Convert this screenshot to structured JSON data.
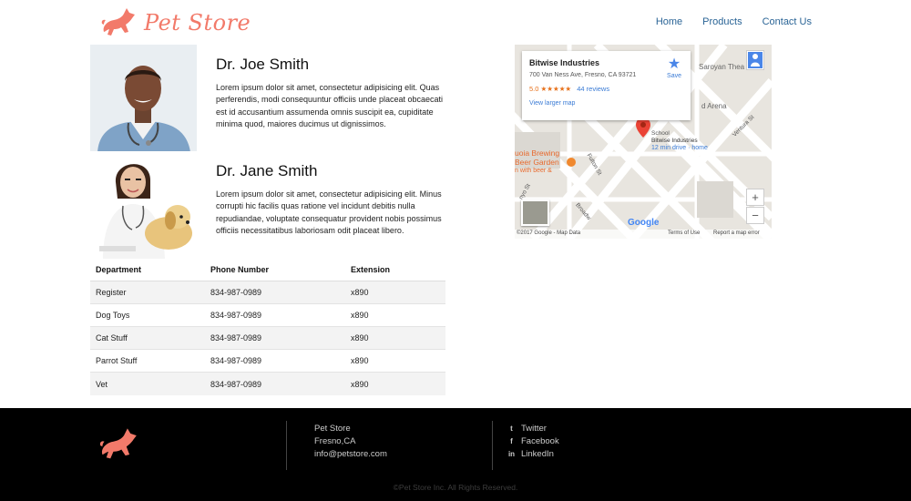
{
  "brand": {
    "name": "Pet Store",
    "accent": "#f27a6a",
    "logo_icon": "running-dog-icon"
  },
  "nav": {
    "items": [
      "Home",
      "Products",
      "Contact Us"
    ]
  },
  "doctors": [
    {
      "name": "Dr. Joe Smith",
      "bio": "Lorem ipsum dolor sit amet, consectetur adipisicing elit. Quas perferendis, modi consequuntur officiis unde placeat obcaecati est id accusantium assumenda omnis suscipit ea, cupiditate minima quod, maiores ducimus ut dignissimos."
    },
    {
      "name": "Dr. Jane Smith",
      "bio": "Lorem ipsum dolor sit amet, consectetur adipisicing elit. Minus corrupti hic facilis quas ratione vel incidunt debitis nulla repudiandae, voluptate consequatur provident nobis possimus officiis necessitatibus laboriosam odit placeat libero."
    }
  ],
  "table": {
    "headers": [
      "Department",
      "Phone Number",
      "Extension"
    ],
    "rows": [
      [
        "Register",
        "834-987-0989",
        "x890"
      ],
      [
        "Dog Toys",
        "834-987-0989",
        "x890"
      ],
      [
        "Cat Stuff",
        "834-987-0989",
        "x890"
      ],
      [
        "Parrot Stuff",
        "834-987-0989",
        "x890"
      ],
      [
        "Vet",
        "834-987-0989",
        "x890"
      ]
    ]
  },
  "map": {
    "place_name": "Bitwise Industries",
    "address": "700 Van Ness Ave, Fresno, CA 93721",
    "rating": "5.0",
    "stars": "★★★★★",
    "reviews": "44 reviews",
    "larger_map": "View larger map",
    "save": "Save",
    "labels": {
      "saroyan": "Saroyan Thea",
      "arena": "d Arena",
      "ventura": "Ventura St",
      "school": "School",
      "marker_name": "Bitwise Industries",
      "drive": "12 min drive · home",
      "brewing_1": "uoia Brewing",
      "brewing_2": "Beer Garden",
      "brewing_3": "n with beer &",
      "fulton": "Fulton St",
      "broadway": "Broadw",
      "van": "nyo St",
      "google": "Google"
    },
    "zoom_in": "+",
    "zoom_out": "−",
    "copyright": "©2017 Google - Map Data",
    "terms": "Terms of Use",
    "report": "Report a map error"
  },
  "footer": {
    "contact": [
      "Pet Store",
      "Fresno,CA",
      "info@petstore.com"
    ],
    "social": [
      {
        "icon": "twitter-icon",
        "glyph": "t",
        "label": "Twitter"
      },
      {
        "icon": "facebook-icon",
        "glyph": "f",
        "label": "Facebook"
      },
      {
        "icon": "linkedin-icon",
        "glyph": "in",
        "label": "LinkedIn"
      }
    ],
    "copyright": "©Pet Store Inc. All Rights Reserved."
  }
}
